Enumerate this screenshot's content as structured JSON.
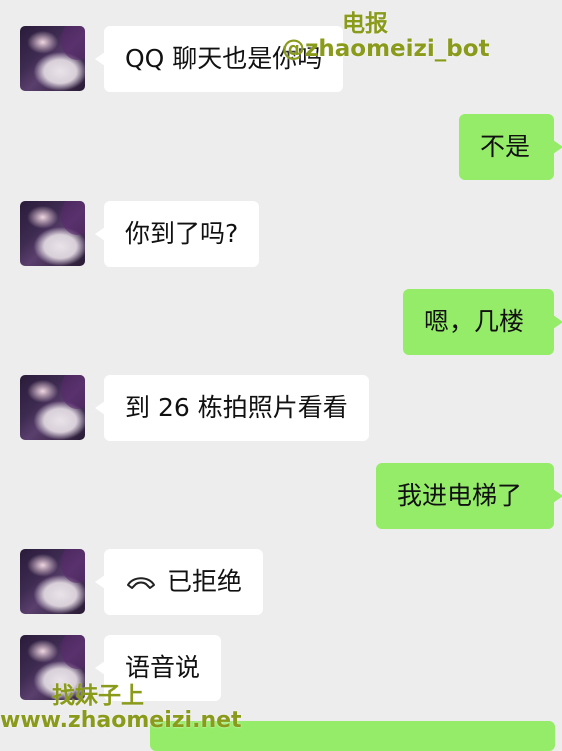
{
  "watermark": {
    "title": "电报",
    "handle": "@zhaomeizi_bot",
    "slogan": "找妹子上",
    "url": "www.zhaomeizi.net"
  },
  "messages": [
    {
      "side": "in",
      "text": "QQ 聊天也是你吗"
    },
    {
      "side": "out",
      "text": "不是"
    },
    {
      "side": "in",
      "text": "你到了吗?"
    },
    {
      "side": "out",
      "text": "嗯，几楼"
    },
    {
      "side": "in",
      "text": "到 26 栋拍照片看看"
    },
    {
      "side": "out",
      "text": "我进电梯了"
    },
    {
      "side": "in",
      "icon": "phone-declined-icon",
      "text": "已拒绝"
    },
    {
      "side": "in",
      "text": "语音说"
    }
  ],
  "colors": {
    "background": "#ededed",
    "incoming_bubble": "#ffffff",
    "outgoing_bubble": "#95ec69",
    "watermark": "#8a9a1a"
  }
}
